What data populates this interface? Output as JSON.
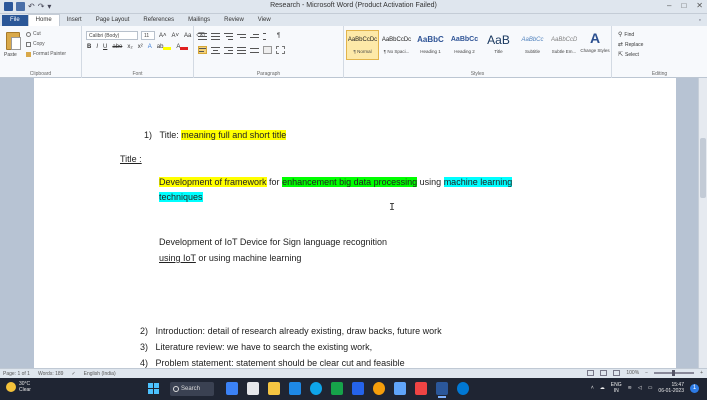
{
  "window": {
    "title": "Research - Microsoft Word (Product Activation Failed)",
    "controls": [
      "–",
      "□",
      "✕"
    ]
  },
  "tabs": [
    {
      "label": "File"
    },
    {
      "label": "Home"
    },
    {
      "label": "Insert"
    },
    {
      "label": "Page Layout"
    },
    {
      "label": "References"
    },
    {
      "label": "Mailings"
    },
    {
      "label": "Review"
    },
    {
      "label": "View"
    }
  ],
  "ribbon": {
    "clipboard": {
      "paste": "Paste",
      "cut": "Cut",
      "copy": "Copy",
      "format_painter": "Format Painter",
      "label": "Clipboard"
    },
    "font": {
      "name": "Calibri (Body)",
      "size": "11",
      "label": "Font",
      "buttons": [
        "B",
        "I",
        "U",
        "abe",
        "x₂",
        "x²"
      ]
    },
    "paragraph": {
      "label": "Paragraph"
    },
    "styles": {
      "label": "Styles",
      "items": [
        {
          "sample": "AaBbCcDc",
          "name": "¶ Normal"
        },
        {
          "sample": "AaBbCcDc",
          "name": "¶ No Spaci..."
        },
        {
          "sample": "AaBbC",
          "name": "Heading 1"
        },
        {
          "sample": "AaBbCc",
          "name": "Heading 2"
        },
        {
          "sample": "AaB",
          "name": "Title"
        },
        {
          "sample": "AaBbCc",
          "name": "Subtitle"
        },
        {
          "sample": "AaBbCcDc",
          "name": "Subtle Em..."
        }
      ],
      "change_styles": "Change Styles"
    },
    "editing": {
      "find": "Find",
      "replace": "Replace",
      "select": "Select",
      "label": "Editing"
    }
  },
  "document": {
    "item1_num": "1)",
    "item1_text": "Title: ",
    "item1_highlight": "meaning full and short title",
    "title_label": "Title :",
    "para1_part1": "Development of framework",
    "para1_part2": " for ",
    "para1_part3": "enhancement big data processing",
    "para1_part4": " using ",
    "para1_part5": "machine learning",
    "para1_line2": "techniques",
    "para2_line1": "Development of IoT Device for Sign language recognition",
    "para2_line2_a": "using IoT",
    "para2_line2_b": " or using machine learning",
    "list": [
      {
        "num": "2)",
        "text": "Introduction: detail of research already existing, draw backs, future work"
      },
      {
        "num": "3)",
        "text": "Literature review: we have to search the existing work,"
      },
      {
        "num": "4)",
        "text": "Problem statement: statement should be clear cut and feasible"
      }
    ]
  },
  "statusbar": {
    "page": "Page: 1 of 1",
    "words": "Words: 189",
    "language": "English (India)",
    "zoom": "100%"
  },
  "taskbar": {
    "weather_temp": "30°C",
    "weather_desc": "Clear",
    "search": "Search",
    "lang": "ENG",
    "region": "IN",
    "time": "15:47",
    "date": "06-01-2023",
    "notifications": "1"
  },
  "colors": {
    "highlight_yellow": "#ffff00",
    "highlight_green": "#00ff00",
    "highlight_cyan": "#00ffff",
    "file_tab": "#2b5797",
    "taskbar": "#1f2533"
  }
}
